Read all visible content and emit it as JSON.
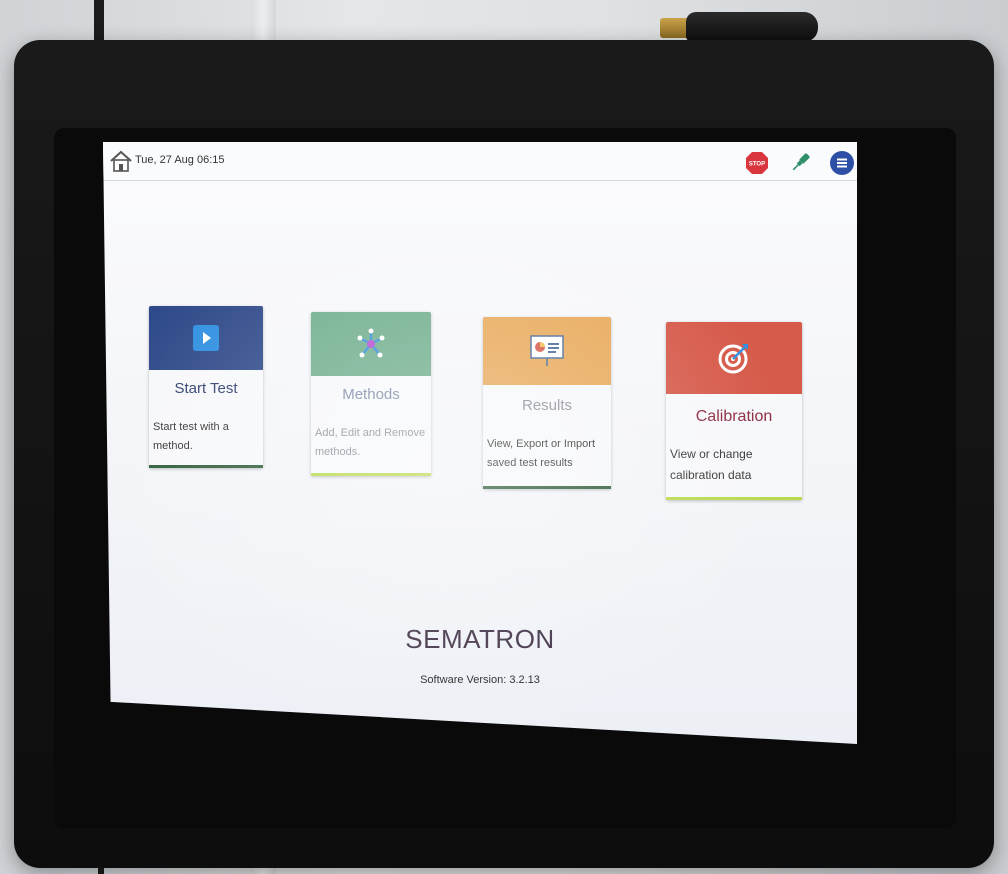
{
  "topbar": {
    "datetime": "Tue, 27 Aug  06:15",
    "stop_label": "STOP"
  },
  "tiles": [
    {
      "title": "Start Test",
      "description": "Start test with a method.",
      "header_color": "#2f4a8a",
      "underline_color": "#2e5d3a",
      "icon": "play-icon"
    },
    {
      "title": "Methods",
      "description": "Add, Edit and Remove methods.",
      "header_color": "#6fae8d",
      "underline_color": "#b8d94c",
      "icon": "methods-icon"
    },
    {
      "title": "Results",
      "description": "View, Export or Import saved test results",
      "header_color": "#e8a95a",
      "underline_color": "#2e5d3a",
      "icon": "presentation-icon"
    },
    {
      "title": "Calibration",
      "description": "View or change calibration data",
      "header_color": "#d65a4a",
      "underline_color": "#b8d94c",
      "icon": "target-icon"
    }
  ],
  "footer": {
    "brand": "SEMATRON",
    "version": "Software Version: 3.2.13"
  },
  "colors": {
    "tile_title": "#2c3e6b",
    "tile_title_faded": "#7d8aa6",
    "calibration_title": "#8a2a3f",
    "stop": "#d9363e",
    "plug": "#2f8f6a",
    "menu": "#2e4fa6"
  }
}
